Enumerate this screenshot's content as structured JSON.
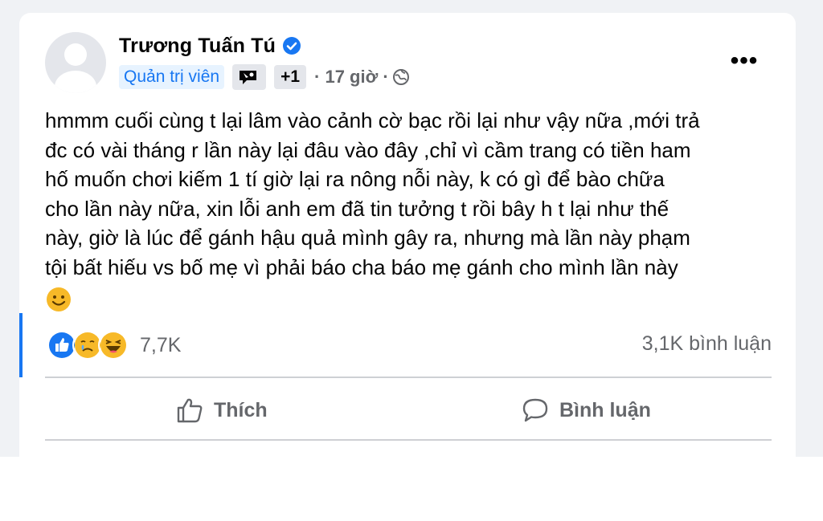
{
  "author": {
    "name": "Trương Tuấn Tú",
    "verified": true
  },
  "meta": {
    "role": "Quản trị viên",
    "extra_badges": "+1",
    "time": "· 17 giờ ·",
    "audience_icon": "globe-icon"
  },
  "post": {
    "lines": [
      "hmmm cuối cùng t lại lâm vào cảnh cờ bạc rồi lại như vậy nữa ,mới trả",
      "đc có vài tháng r lần này lại đâu vào đây ,chỉ vì cầm trang có tiền ham",
      "hố muốn chơi kiếm 1 tí giờ lại ra nông nỗi này, k có gì để bào chữa",
      "cho lần này nữa, xin lỗi anh em đã tin tưởng t rồi bây h t lại như thế",
      "này, giờ là lúc để gánh hậu quả mình gây ra, nhưng mà lần này phạm",
      "tội bất hiếu vs bố mẹ vì phải báo cha báo mẹ gánh cho mình lần này"
    ],
    "emoji": "smile-emoji"
  },
  "stats": {
    "reactions": [
      "like-icon",
      "sad-icon",
      "haha-icon"
    ],
    "reaction_count": "7,7K",
    "comment_count": "3,1K bình luận"
  },
  "actions": {
    "like_label": "Thích",
    "comment_label": "Bình luận"
  },
  "colors": {
    "accent": "#1877f2",
    "page_bg": "#f0f2f5",
    "secondary_text": "#65676b"
  }
}
